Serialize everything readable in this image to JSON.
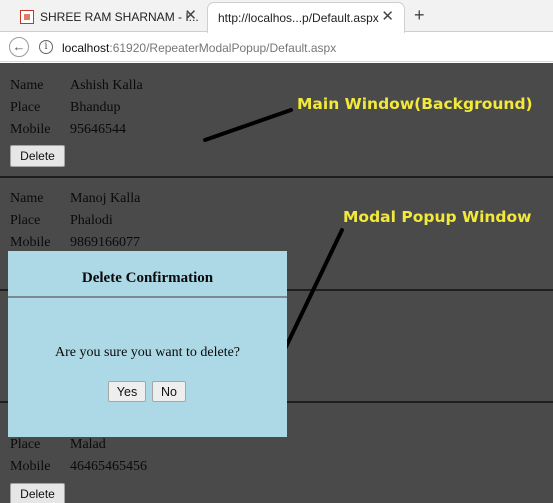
{
  "browser": {
    "tabs": [
      {
        "title": "SHREE RAM SHARNAM - I..."
      },
      {
        "title": "http://localhos...p/Default.aspx"
      }
    ],
    "new_tab_label": "+",
    "url_host": "localhost",
    "url_rest": ":61920/RepeaterModalPopup/Default.aspx"
  },
  "records": [
    {
      "name_label": "Name",
      "name": "Ashish Kalla",
      "place_label": "Place",
      "place": "Bhandup",
      "mobile_label": "Mobile",
      "mobile": "95646544",
      "delete_label": "Delete"
    },
    {
      "name_label": "Name",
      "name": "Manoj Kalla",
      "place_label": "Place",
      "place": "Phalodi",
      "mobile_label": "Mobile",
      "mobile": "9869166077"
    },
    {
      "place_label": "Place",
      "place": "Malad",
      "mobile_label": "Mobile",
      "mobile": "46465465456",
      "delete_label": "Delete"
    }
  ],
  "annotations": {
    "main_window": "Main Window(Background)",
    "modal_window": "Modal Popup Window",
    "color": "#f2e93a"
  },
  "modal": {
    "title": "Delete Confirmation",
    "message": "Are you sure you want to delete?",
    "yes_label": "Yes",
    "no_label": "No",
    "background": "#add8e6"
  },
  "colors": {
    "overlay": "#4a4a4a"
  }
}
